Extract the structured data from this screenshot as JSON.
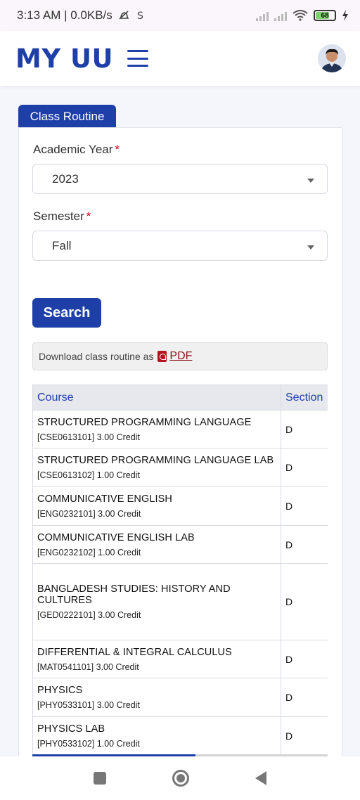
{
  "status_bar": {
    "time_net": "3:13 AM | 0.0KB/s",
    "battery": "68"
  },
  "header": {
    "logo": "MY UU"
  },
  "panel": {
    "tab_title": "Class Routine",
    "year_label": "Academic Year",
    "year_value": "2023",
    "semester_label": "Semester",
    "semester_value": "Fall",
    "required_mark": "*",
    "search_label": "Search",
    "download_text": "Download class routine as",
    "pdf_label": "PDF"
  },
  "table": {
    "headers": {
      "course": "Course",
      "section": "Section"
    },
    "rows": [
      {
        "name": "STRUCTURED PROGRAMMING LANGUAGE",
        "code": "[CSE0613101] 3.00 Credit",
        "section": "D"
      },
      {
        "name": "STRUCTURED PROGRAMMING LANGUAGE LAB",
        "code": "[CSE0613102] 1.00 Credit",
        "section": "D"
      },
      {
        "name": "COMMUNICATIVE ENGLISH",
        "code": "[ENG0232101] 3.00 Credit",
        "section": "D"
      },
      {
        "name": "COMMUNICATIVE ENGLISH LAB",
        "code": "[ENG0232102] 1.00 Credit",
        "section": "D"
      },
      {
        "name": "BANGLADESH STUDIES: HISTORY AND CULTURES",
        "code": "[GED0222101] 3.00 Credit",
        "section": "D"
      },
      {
        "name": "DIFFERENTIAL & INTEGRAL CALCULUS",
        "code": "[MAT0541101] 3.00 Credit",
        "section": "D"
      },
      {
        "name": "PHYSICS",
        "code": "[PHY0533101] 3.00 Credit",
        "section": "D"
      },
      {
        "name": "PHYSICS LAB",
        "code": "[PHY0533102] 1.00 Credit",
        "section": "D"
      }
    ]
  },
  "icons": {
    "menu": "hamburger-icon",
    "dropdown": "chevron-down-icon",
    "pdf": "pdf-icon",
    "nav_recents": "recents-icon",
    "nav_home": "home-icon",
    "nav_back": "back-icon"
  },
  "colors": {
    "brand": "#1f3fa8",
    "required": "#d0021b",
    "pdf": "#8a1212"
  }
}
